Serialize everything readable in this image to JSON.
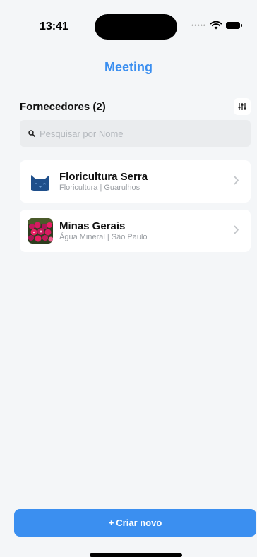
{
  "status_bar": {
    "time": "13:41",
    "signal_icon": "signal-dots-icon",
    "wifi_icon": "wifi-icon",
    "battery_icon": "battery-icon"
  },
  "nav": {
    "title": "Meeting"
  },
  "section": {
    "title": "Fornecedores (2)",
    "filter_icon": "filter-sliders-icon"
  },
  "search": {
    "placeholder": "Pesquisar por Nome",
    "value": "",
    "icon": "search-icon"
  },
  "suppliers": [
    {
      "name": "Floricultura Serra",
      "subtitle": "Floricultura | Guarulhos",
      "avatar_icon": "cat-logo-icon"
    },
    {
      "name": "Minas Gerais",
      "subtitle": "Água Mineral | São Paulo",
      "avatar_icon": "flowers-photo-icon"
    }
  ],
  "actions": {
    "create_label": "Criar novo",
    "create_icon": "plus-icon"
  },
  "colors": {
    "accent": "#3b8ff0",
    "background": "#f4f6f8",
    "card": "#ffffff",
    "search_bg": "#eaecee",
    "logo_blue": "#1f4f8b"
  }
}
